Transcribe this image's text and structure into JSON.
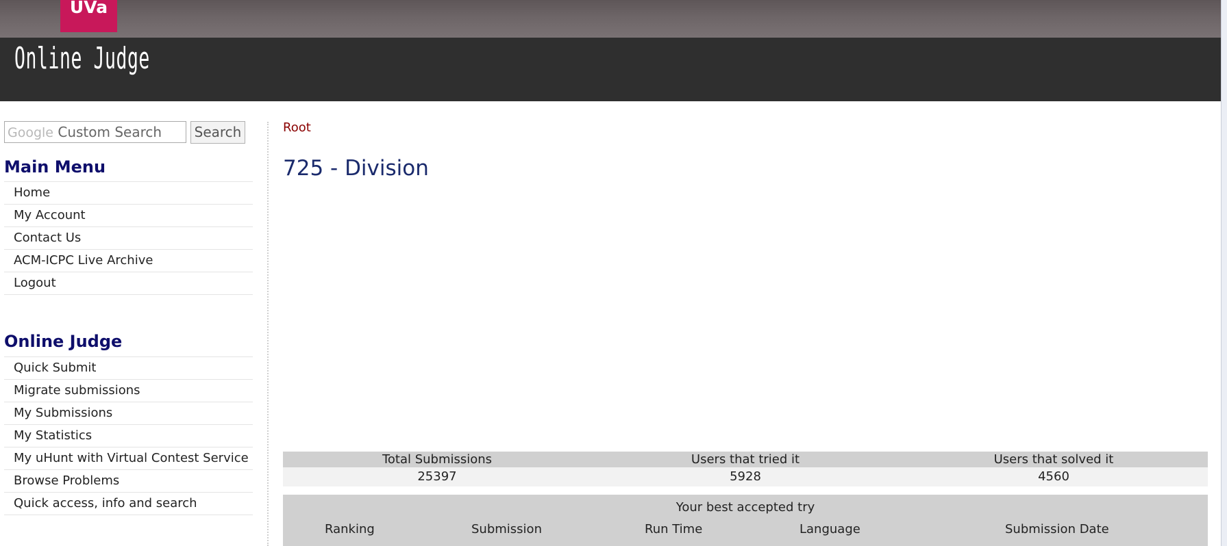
{
  "header": {
    "logo_text": "UVa",
    "site_title": "Online Judge",
    "colors": {
      "logo": "#c8185a",
      "banner": "#2f2f2f",
      "topbar": "#6d6567"
    }
  },
  "search": {
    "google_label": "Google",
    "placeholder": "Custom Search",
    "button_label": "Search"
  },
  "main_menu": {
    "title": "Main Menu",
    "items": [
      {
        "label": "Home"
      },
      {
        "label": "My Account"
      },
      {
        "label": "Contact Us"
      },
      {
        "label": "ACM-ICPC Live Archive"
      },
      {
        "label": "Logout"
      }
    ]
  },
  "online_judge_menu": {
    "title": "Online Judge",
    "items": [
      {
        "label": "Quick Submit"
      },
      {
        "label": "Migrate submissions"
      },
      {
        "label": "My Submissions"
      },
      {
        "label": "My Statistics"
      },
      {
        "label": "My uHunt with Virtual Contest Service"
      },
      {
        "label": "Browse Problems"
      },
      {
        "label": "Quick access, info and search"
      }
    ]
  },
  "content": {
    "breadcrumb": "Root",
    "problem_title": "725 - Division"
  },
  "stats": {
    "headers": [
      "Total Submissions",
      "Users that tried it",
      "Users that solved it"
    ],
    "values": [
      "25397",
      "5928",
      "4560"
    ]
  },
  "best_try": {
    "title": "Your best accepted try",
    "columns": [
      "Ranking",
      "Submission",
      "Run Time",
      "Language",
      "Submission Date"
    ]
  }
}
